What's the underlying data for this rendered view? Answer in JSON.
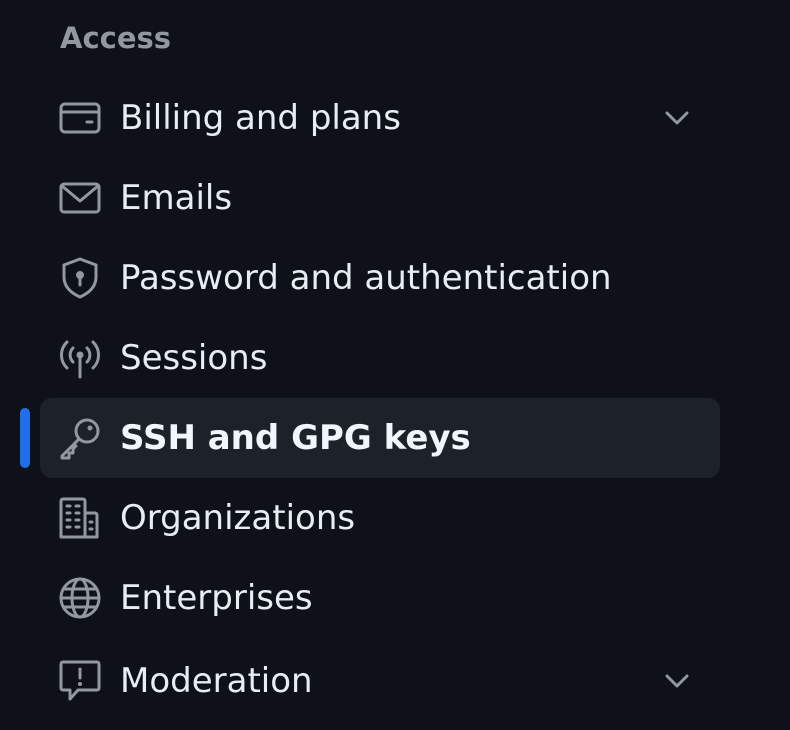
{
  "sidebar": {
    "section_title": "Access",
    "items": [
      {
        "label": "Billing and plans",
        "icon": "credit-card-icon",
        "expandable": true
      },
      {
        "label": "Emails",
        "icon": "mail-icon"
      },
      {
        "label": "Password and authentication",
        "icon": "shield-lock-icon"
      },
      {
        "label": "Sessions",
        "icon": "broadcast-icon"
      },
      {
        "label": "SSH and GPG keys",
        "icon": "key-icon",
        "active": true
      },
      {
        "label": "Organizations",
        "icon": "organization-icon"
      },
      {
        "label": "Enterprises",
        "icon": "globe-icon"
      },
      {
        "label": "Moderation",
        "icon": "report-icon",
        "expandable": true
      }
    ]
  },
  "colors": {
    "background": "#0e1117",
    "text": "#e6edf3",
    "muted": "#9198a1",
    "icon": "#9198a1",
    "active_background": "#1d2129",
    "accent": "#1f6feb"
  }
}
